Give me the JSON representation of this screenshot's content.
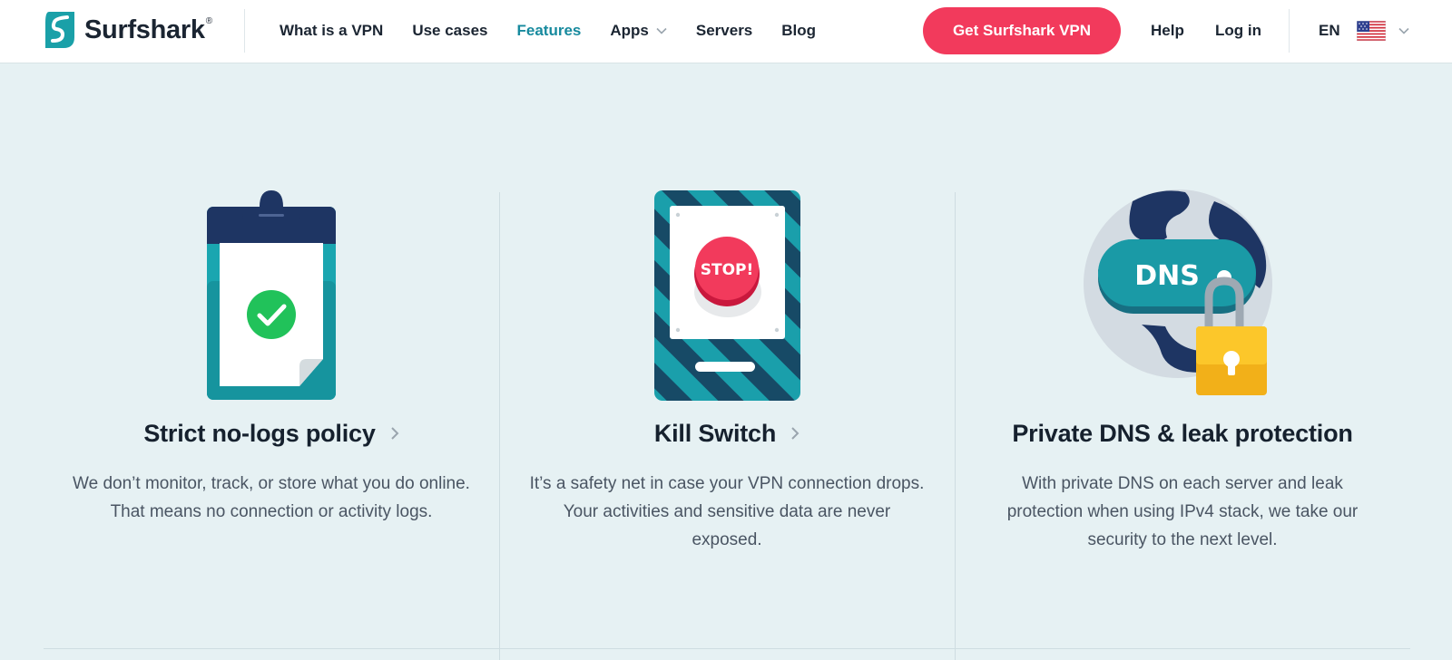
{
  "brand": {
    "name": "Surfshark",
    "reg": "®"
  },
  "nav": {
    "items": [
      {
        "label": "What is a VPN",
        "active": false,
        "dropdown": false
      },
      {
        "label": "Use cases",
        "active": false,
        "dropdown": false
      },
      {
        "label": "Features",
        "active": true,
        "dropdown": false
      },
      {
        "label": "Apps",
        "active": false,
        "dropdown": true
      },
      {
        "label": "Servers",
        "active": false,
        "dropdown": false
      },
      {
        "label": "Blog",
        "active": false,
        "dropdown": false
      }
    ],
    "cta_label": "Get Surfshark VPN",
    "help_label": "Help",
    "login_label": "Log in",
    "language": "EN",
    "flag_icon": "us-flag-icon"
  },
  "features": [
    {
      "title": "Strict no-logs policy",
      "has_arrow": true,
      "icon": "clipboard-check-icon",
      "description": "We don’t monitor, track, or store what you do online. That means no connection or activity logs."
    },
    {
      "title": "Kill Switch",
      "has_arrow": true,
      "icon": "stop-button-icon",
      "button_text": "STOP!",
      "description": "It’s a safety net in case your VPN connection drops. Your activities and sensitive data are never exposed."
    },
    {
      "title": "Private DNS & leak protection",
      "has_arrow": false,
      "icon": "dns-globe-lock-icon",
      "badge_text": "DNS",
      "description": "With private DNS on each server and leak protection when using IPv4 stack, we take our security to the next level."
    }
  ],
  "colors": {
    "accent": "#178a9e",
    "cta": "#f23a5c",
    "background": "#e6f1f3",
    "text": "#16212e"
  }
}
